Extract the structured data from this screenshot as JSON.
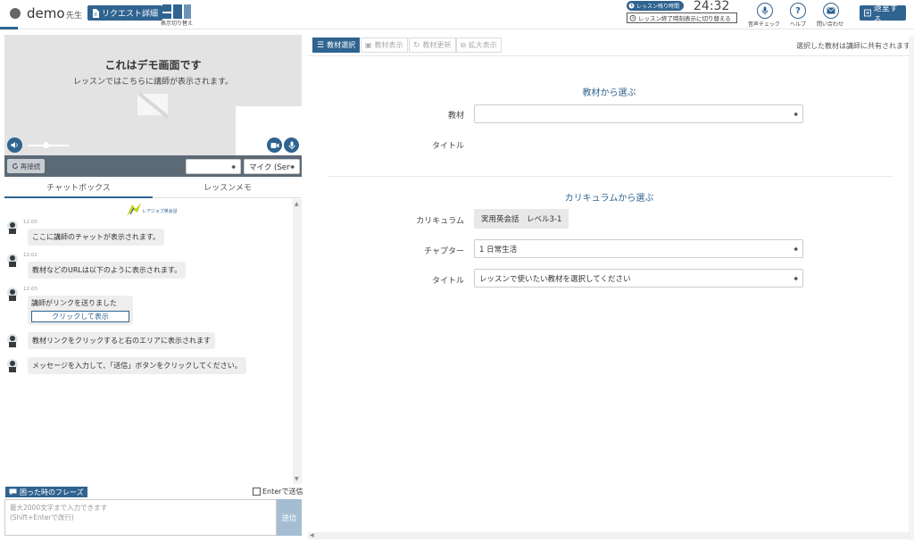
{
  "header": {
    "user_name": "demo",
    "user_role": "先生",
    "request_button": "リクエスト詳細",
    "layout_toggle_label": "表示切り替え",
    "timer_badge": "レッスン残り時間",
    "timer_value": "24:32",
    "timer_switch": "レッスン終了時刻表示に切り替える",
    "audio_check": "音声チェック",
    "help": "ヘルプ",
    "contact": "問い合わせ",
    "logout": "退室する"
  },
  "video": {
    "title": "これはデモ画面です",
    "subtitle": "レッスンではこちらに講師が表示されます。",
    "volume_level": 0.45
  },
  "controls": {
    "reconnect": "再接続",
    "camera_select": "",
    "mic_select": "マイク (Sen"
  },
  "left_tabs": {
    "chatbox": "チャットボックス",
    "memo": "レッスンメモ"
  },
  "chat": {
    "logo_text": "レアジョブ英会話",
    "messages": [
      {
        "time": "12:00",
        "text": "ここに講師のチャットが表示されます。"
      },
      {
        "time": "12:02",
        "text": "教材などのURLは以下のように表示されます。"
      },
      {
        "time": "12:03",
        "text": "講師がリンクを送りました",
        "link": "クリックして表示"
      },
      {
        "time": "",
        "text": "教材リンクをクリックすると右のエリアに表示されます"
      },
      {
        "time": "",
        "text": "メッセージを入力して、「送信」ボタンをクリックしてください。"
      }
    ],
    "phrase_button": "困った時のフレーズ",
    "enter_send": "Enterで送信",
    "input_placeholder_1": "最大2000文字まで入力できます",
    "input_placeholder_2": "(Shift+Enterで改行)",
    "send": "送信"
  },
  "right_tabs": {
    "select": "教材選択",
    "display": "教材表示",
    "refresh": "教材更新",
    "expand": "拡大表示"
  },
  "share_note": "選択した教材は講師に共有されます",
  "material_section": {
    "title": "教材から選ぶ",
    "material_label": "教材",
    "material_value": "",
    "title_label": "タイトル"
  },
  "curriculum_section": {
    "title": "カリキュラムから選ぶ",
    "curriculum_label": "カリキュラム",
    "curriculum_value": "実用英会話　レベル3-1",
    "chapter_label": "チャプター",
    "chapter_value": "1 日常生活",
    "title_label": "タイトル",
    "title_value": "レッスンで使いたい教材を選択してください"
  },
  "colors": {
    "primary": "#2f6390",
    "send_disabled": "#a5bdd3",
    "control_bar": "#5c6a76"
  }
}
